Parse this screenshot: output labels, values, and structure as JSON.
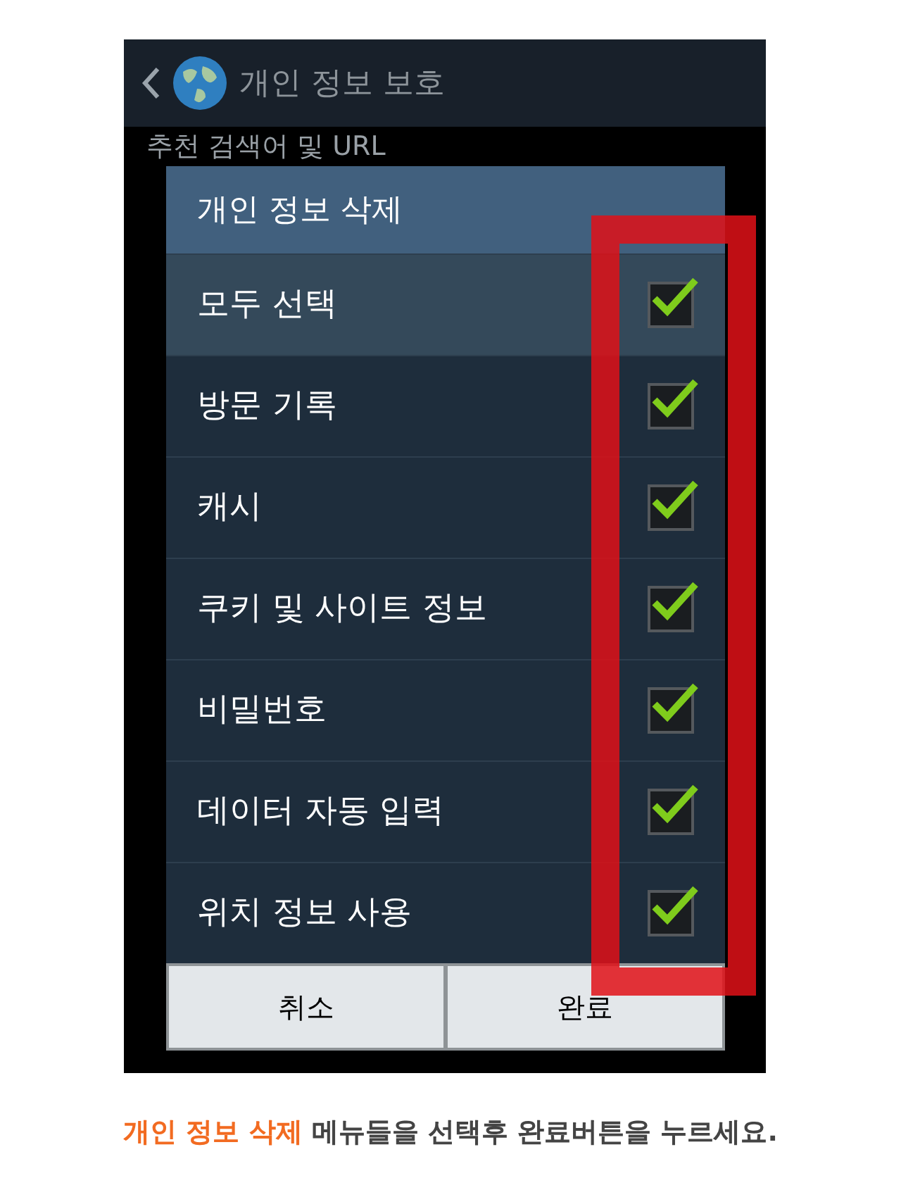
{
  "action_bar": {
    "title": "개인 정보 보호"
  },
  "background_setting": {
    "title": "추천 검색어 및 URL"
  },
  "dialog": {
    "title": "개인 정보 삭제",
    "items": [
      {
        "label": "모두 선택",
        "selected": true,
        "checked": true
      },
      {
        "label": "방문 기록",
        "selected": false,
        "checked": true
      },
      {
        "label": "캐시",
        "selected": false,
        "checked": true
      },
      {
        "label": "쿠키 및 사이트 정보",
        "selected": false,
        "checked": true
      },
      {
        "label": "비밀번호",
        "selected": false,
        "checked": true
      },
      {
        "label": "데이터 자동 입력",
        "selected": false,
        "checked": true
      },
      {
        "label": "위치 정보 사용",
        "selected": false,
        "checked": true
      }
    ],
    "buttons": [
      "취소",
      "완료"
    ]
  },
  "caption": {
    "highlight": "개인 정보 삭제",
    "text": "메뉴들을 선택후 완료버튼을 누르세요."
  }
}
